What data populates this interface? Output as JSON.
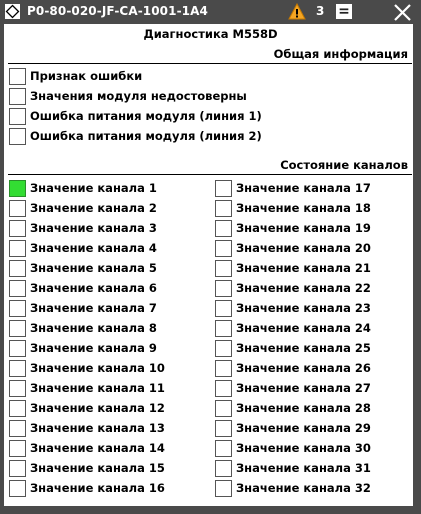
{
  "window": {
    "title": "P0-80-020-JF-CA-1001-1A4",
    "warning_count": "3",
    "icons": {
      "app": "diamond-icon",
      "warning": "warning-icon",
      "menu": "menu-icon",
      "close": "close-icon"
    }
  },
  "header": "Диагностика M558D",
  "general": {
    "title": "Общая информация",
    "items": [
      {
        "label": "Признак ошибки",
        "active": false
      },
      {
        "label": "Значения модуля недостоверны",
        "active": false
      },
      {
        "label": "Ошибка питания модуля (линия 1)",
        "active": false
      },
      {
        "label": "Ошибка питания модуля (линия 2)",
        "active": false
      }
    ]
  },
  "channels": {
    "title": "Состояние каналов",
    "items": [
      {
        "label": "Значение канала 1",
        "active": true
      },
      {
        "label": "Значение канала 2",
        "active": false
      },
      {
        "label": "Значение канала 3",
        "active": false
      },
      {
        "label": "Значение канала 4",
        "active": false
      },
      {
        "label": "Значение канала 5",
        "active": false
      },
      {
        "label": "Значение канала 6",
        "active": false
      },
      {
        "label": "Значение канала 7",
        "active": false
      },
      {
        "label": "Значение канала 8",
        "active": false
      },
      {
        "label": "Значение канала 9",
        "active": false
      },
      {
        "label": "Значение канала 10",
        "active": false
      },
      {
        "label": "Значение канала 11",
        "active": false
      },
      {
        "label": "Значение канала 12",
        "active": false
      },
      {
        "label": "Значение канала 13",
        "active": false
      },
      {
        "label": "Значение канала 14",
        "active": false
      },
      {
        "label": "Значение канала 15",
        "active": false
      },
      {
        "label": "Значение канала 16",
        "active": false
      },
      {
        "label": "Значение канала 17",
        "active": false
      },
      {
        "label": "Значение канала 18",
        "active": false
      },
      {
        "label": "Значение канала 19",
        "active": false
      },
      {
        "label": "Значение канала 20",
        "active": false
      },
      {
        "label": "Значение канала 21",
        "active": false
      },
      {
        "label": "Значение канала 22",
        "active": false
      },
      {
        "label": "Значение канала 23",
        "active": false
      },
      {
        "label": "Значение канала 24",
        "active": false
      },
      {
        "label": "Значение канала 25",
        "active": false
      },
      {
        "label": "Значение канала 26",
        "active": false
      },
      {
        "label": "Значение канала 27",
        "active": false
      },
      {
        "label": "Значение канала 28",
        "active": false
      },
      {
        "label": "Значение канала 29",
        "active": false
      },
      {
        "label": "Значение канала 30",
        "active": false
      },
      {
        "label": "Значение канала 31",
        "active": false
      },
      {
        "label": "Значение канала 32",
        "active": false
      }
    ]
  },
  "colors": {
    "titlebar": "#4a4a4a",
    "active": "#33dd33",
    "inactive": "#ffffff"
  }
}
